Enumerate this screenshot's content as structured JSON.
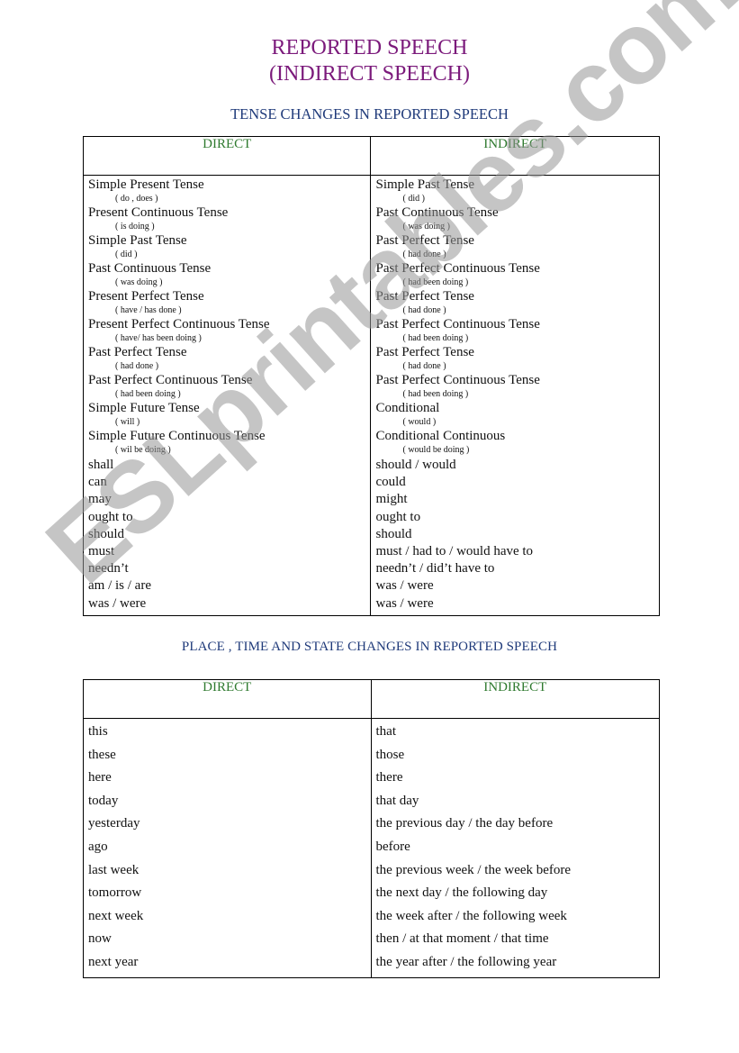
{
  "title_line1": "REPORTED SPEECH",
  "title_line2": "(INDIRECT SPEECH)",
  "colors": {
    "title": "#7b1a7b",
    "section": "#1f3a7a",
    "header": "#2f7a2f",
    "watermark": "#969696"
  },
  "watermark": "ESLprintables.com",
  "tense_section": {
    "heading": "TENSE CHANGES IN REPORTED SPEECH",
    "col_direct": "DIRECT",
    "col_indirect": "INDIRECT",
    "tenses": [
      {
        "direct": "Simple Present Tense",
        "direct_form": "( do ,  does  )",
        "indirect": "Simple Past Tense",
        "indirect_form": "( did )"
      },
      {
        "direct": "Present Continuous Tense",
        "direct_form": "(  is  doing  )",
        "indirect": "Past Continuous Tense",
        "indirect_form": "(  was doing )"
      },
      {
        "direct": "Simple Past Tense",
        "direct_form": "( did )",
        "indirect": "Past Perfect Tense",
        "indirect_form": "(  had  done )"
      },
      {
        "direct": "Past Continuous Tense",
        "direct_form": "( was  doing  )",
        "indirect": "Past Perfect Continuous Tense",
        "indirect_form": "( had been  doing  )"
      },
      {
        "direct": "Present Perfect Tense",
        "direct_form": "( have  /  has   done  )",
        "indirect": "Past Perfect Tense",
        "indirect_form": "(  had  done )"
      },
      {
        "direct": "Present Perfect Continuous Tense",
        "direct_form": "( have/ has been doing )",
        "indirect": "Past Perfect Continuous Tense",
        "indirect_form": "( had been doing )"
      },
      {
        "direct": "Past Perfect Tense",
        "direct_form": "(  had done )",
        "indirect": "Past Perfect Tense",
        "indirect_form": "( had done )"
      },
      {
        "direct": "Past Perfect Continuous Tense",
        "direct_form": "( had been doing )",
        "indirect": "Past Perfect Continuous Tense",
        "indirect_form": "( had been doing )"
      },
      {
        "direct": "Simple Future Tense",
        "direct_form": "( will )",
        "indirect": "Conditional",
        "indirect_form": "( would )"
      },
      {
        "direct": "Simple Future Continuous Tense",
        "direct_form": "( wil be doing )",
        "indirect": "Conditional Continuous",
        "indirect_form": "( would be doing )"
      }
    ],
    "modals": [
      {
        "direct": "shall",
        "indirect": "should / would"
      },
      {
        "direct": "can",
        "indirect": "could"
      },
      {
        "direct": "may",
        "indirect": "might"
      },
      {
        "direct": "ought to",
        "indirect": "ought to"
      },
      {
        "direct": "should",
        "indirect": "should"
      },
      {
        "direct": "must",
        "indirect": "must / had to / would have to"
      },
      {
        "direct": "needn’t",
        "indirect": "needn’t / did’t have to"
      },
      {
        "direct": "am / is / are",
        "indirect": "was / were"
      },
      {
        "direct": "was / were",
        "indirect": "was / were"
      }
    ]
  },
  "place_section": {
    "heading": "PLACE , TIME AND STATE CHANGES  IN REPORTED SPEECH",
    "col_direct": "DIRECT",
    "col_indirect": "INDIRECT",
    "rows": [
      {
        "direct": "this",
        "indirect": "that"
      },
      {
        "direct": "these",
        "indirect": "those"
      },
      {
        "direct": "here",
        "indirect": "there"
      },
      {
        "direct": "today",
        "indirect": "that day"
      },
      {
        "direct": "yesterday",
        "indirect": "the previous day / the day before"
      },
      {
        "direct": "ago",
        "indirect": "before"
      },
      {
        "direct": "last week",
        "indirect": "the previous week / the week before"
      },
      {
        "direct": "tomorrow",
        "indirect": "the next day  / the following day"
      },
      {
        "direct": "next week",
        "indirect": "the week after  /  the following week"
      },
      {
        "direct": "now",
        "indirect": "then  / at that moment / that time"
      },
      {
        "direct": "next year",
        "indirect": "the year after  /  the following year"
      }
    ]
  }
}
